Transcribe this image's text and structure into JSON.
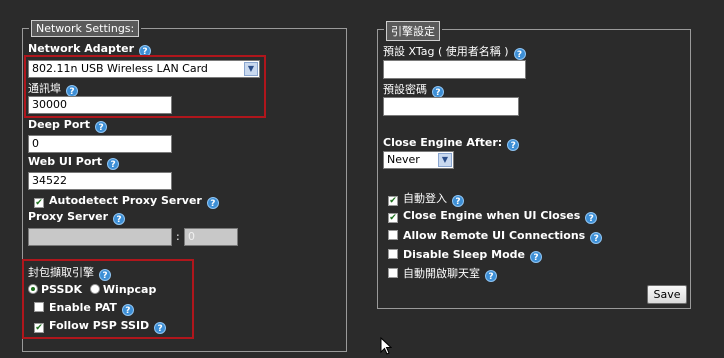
{
  "network": {
    "legend": "Network Settings:",
    "adapter_label": "Network Adapter",
    "adapter_value": "802.11n USB Wireless LAN Card",
    "comm_port_label": "通訊埠",
    "comm_port_value": "30000",
    "deep_port_label": "Deep Port",
    "deep_port_value": "0",
    "web_ui_port_label": "Web UI Port",
    "web_ui_port_value": "34522",
    "autodetect_proxy_label": "Autodetect Proxy Server",
    "proxy_server_label": "Proxy Server",
    "proxy_host_value": "",
    "proxy_sep": ":",
    "proxy_port_value": "0",
    "packet_engine_label": "封包擷取引擎",
    "pssdk_label": "PSSDK",
    "winpcap_label": "Winpcap",
    "enable_pat_label": "Enable PAT",
    "follow_psp_label": "Follow PSP SSID"
  },
  "engine": {
    "legend": "引擎設定",
    "xtag_label": "預設 XTag ( 使用者名稱 )",
    "xtag_value": "",
    "password_label": "預設密碼",
    "password_value": "",
    "close_after_label": "Close Engine After:",
    "close_after_value": "Never",
    "auto_login_label": "自動登入",
    "close_on_ui_label": "Close Engine when UI Closes",
    "allow_remote_label": "Allow Remote UI Connections",
    "disable_sleep_label": "Disable Sleep Mode",
    "auto_chat_label": "自動開啟聊天室",
    "save_label": "Save"
  },
  "icons": {
    "help": "?",
    "check": "✔",
    "arrow": "▼"
  },
  "checkboxes": {
    "autodetect_proxy": true,
    "enable_pat": false,
    "follow_psp": true,
    "auto_login": true,
    "close_on_ui": true,
    "allow_remote": false,
    "disable_sleep": false,
    "auto_chat": false
  },
  "colors": {
    "help_icon": "#3d8fd6",
    "highlight_box": "#b0161c",
    "background": "#2b2b2b"
  }
}
